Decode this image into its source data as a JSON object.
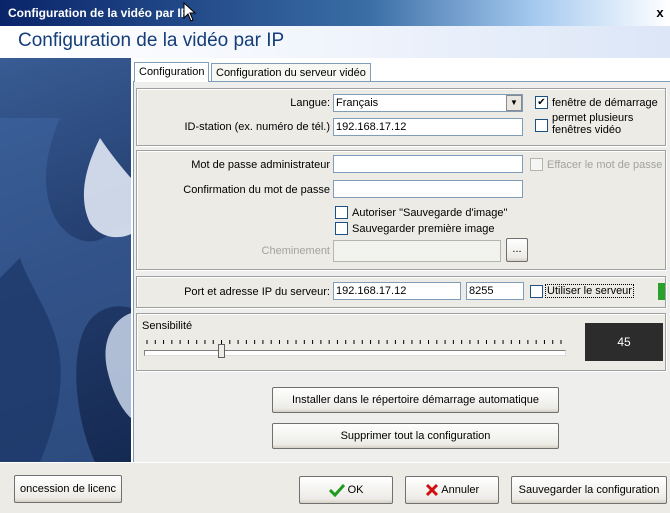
{
  "window": {
    "title": "Configuration de la vidéo par IP",
    "close_glyph": "x",
    "header_title": "Configuration de la vidéo par IP"
  },
  "tabs": [
    {
      "label": "Configuration",
      "active": true
    },
    {
      "label": "Configuration du serveur vidéo",
      "active": false
    }
  ],
  "group_general": {
    "language_label": "Langue:",
    "language_value": "Français",
    "station_label": "ID-station (ex. numéro de tél.)",
    "station_value": "192.168.17.12",
    "startup_window_label": "fenêtre de démarrage",
    "startup_window_checked": true,
    "multi_window_label_1": "permet plusieurs",
    "multi_window_label_2": "fenêtres vidéo",
    "multi_window_checked": false
  },
  "group_password": {
    "admin_password_label": "Mot de passe administrateur",
    "admin_password_value": "",
    "erase_password_label": "Effacer le mot de passe",
    "confirm_password_label": "Confirmation du mot de passe",
    "confirm_password_value": "",
    "allow_save_image_label": "Autoriser \"Sauvegarde d'image\"",
    "save_first_image_label": "Sauvegarder première image",
    "path_label": "Cheminement",
    "path_value": "",
    "browse_label": "..."
  },
  "group_server": {
    "label": "Port et adresse IP du serveur:",
    "ip_value": "192.168.17.12",
    "port_value": "8255",
    "use_server_label": "Utiliser le serveur",
    "use_server_checked": false
  },
  "sensitivity": {
    "label": "Sensibilité",
    "value": 45,
    "display": "45",
    "min": 0,
    "max": 250
  },
  "actions": {
    "install_autostart": "Installer dans le répertoire démarrage automatique",
    "delete_config": "Supprimer tout la configuration"
  },
  "footer": {
    "license_button": "oncession de licenc",
    "ok_button": "OK",
    "cancel_button": "Annuler",
    "save_config_button": "Sauvegarder la configuration"
  },
  "colors": {
    "status_light": "#2aa12a",
    "ok_check": "#1e9a1e",
    "cancel_x": "#d01010"
  }
}
